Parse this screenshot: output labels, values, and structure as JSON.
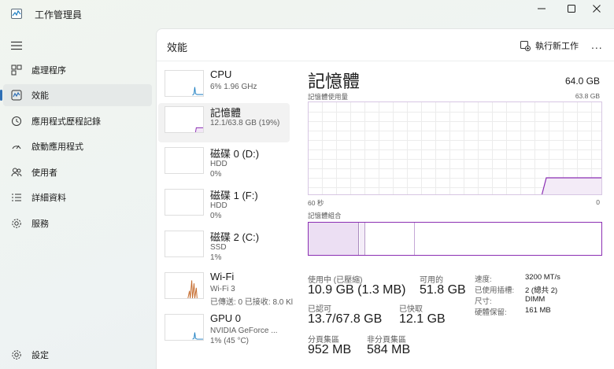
{
  "window": {
    "title": "工作管理員",
    "buttons": [
      "minimize",
      "maximize",
      "close"
    ]
  },
  "nav": {
    "items": [
      {
        "label": "處理程序",
        "icon": "processes-icon"
      },
      {
        "label": "效能",
        "icon": "performance-icon",
        "active": true
      },
      {
        "label": "應用程式歷程記錄",
        "icon": "app-history-icon"
      },
      {
        "label": "啟動應用程式",
        "icon": "startup-apps-icon"
      },
      {
        "label": "使用者",
        "icon": "users-icon"
      },
      {
        "label": "詳細資料",
        "icon": "details-icon"
      },
      {
        "label": "服務",
        "icon": "services-icon"
      }
    ],
    "settings_label": "設定"
  },
  "header": {
    "title": "效能",
    "run_task_label": "執行新工作",
    "more_label": "..."
  },
  "devices": [
    {
      "name": "CPU",
      "sub1": "6% 1.96 GHz",
      "sub2": "",
      "color": "#1e7fc2"
    },
    {
      "name": "記憶體",
      "sub1": "12.1/63.8 GB (19%)",
      "sub2": "",
      "color": "#8b2fb3",
      "active": true
    },
    {
      "name": "磁碟 0 (D:)",
      "sub1": "HDD",
      "sub2": "0%",
      "color": "#4f9b35"
    },
    {
      "name": "磁碟 1 (F:)",
      "sub1": "HDD",
      "sub2": "0%",
      "color": "#4f9b35"
    },
    {
      "name": "磁碟 2 (C:)",
      "sub1": "SSD",
      "sub2": "1%",
      "color": "#4f9b35"
    },
    {
      "name": "Wi-Fi",
      "sub1": "Wi-Fi 3",
      "sub2": "已傳送: 0 已接收: 8.0 Kl",
      "color": "#c56b2d"
    },
    {
      "name": "GPU 0",
      "sub1": "NVIDIA GeForce ...",
      "sub2": "1% (45 °C)",
      "color": "#1e7fc2"
    }
  ],
  "memory": {
    "title": "記憶體",
    "total": "64.0 GB",
    "usage_label": "記憶體使用量",
    "usage_max": "63.8 GB",
    "time_left": "60 秒",
    "time_right": "0",
    "composition_label": "記憶體組合",
    "usage_fraction": 0.19,
    "stats": {
      "in_use_label": "使用中 (已壓縮)",
      "in_use_value": "10.9 GB (1.3 MB)",
      "available_label": "可用的",
      "available_value": "51.8 GB",
      "committed_label": "已認可",
      "committed_value": "13.7/67.8 GB",
      "cached_label": "已快取",
      "cached_value": "12.1 GB",
      "paged_pool_label": "分頁集區",
      "paged_pool_value": "952 MB",
      "nonpaged_pool_label": "非分頁集區",
      "nonpaged_pool_value": "584 MB"
    },
    "properties": [
      {
        "label": "速度:",
        "value": "3200 MT/s"
      },
      {
        "label": "已使用插槽:",
        "value": "2 (總共 2)"
      },
      {
        "label": "尺寸:",
        "value": "DIMM"
      },
      {
        "label": "硬體保留:",
        "value": "161 MB"
      }
    ]
  }
}
